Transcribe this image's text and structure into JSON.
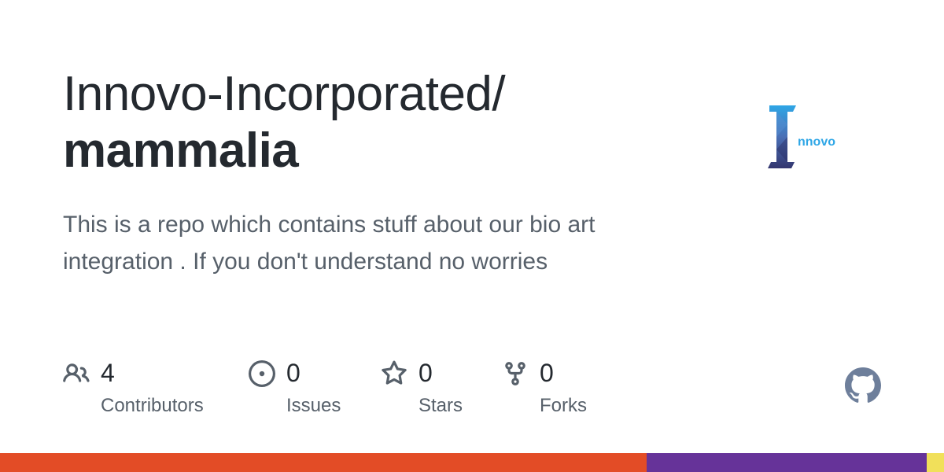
{
  "repo": {
    "owner": "Innovo-Incorporated/",
    "name": "mammalia",
    "description": "This is a repo which contains stuff about our bio art integration . If you don't understand no worries"
  },
  "logo": {
    "wordmark": "nnovo",
    "colors": {
      "dark": "#3b3f7e",
      "light": "#2ea6e6"
    }
  },
  "stats": [
    {
      "icon": "people-icon",
      "value": "4",
      "label": "Contributors"
    },
    {
      "icon": "issue-opened-icon",
      "value": "0",
      "label": "Issues"
    },
    {
      "icon": "star-icon",
      "value": "0",
      "label": "Stars"
    },
    {
      "icon": "repo-forked-icon",
      "value": "0",
      "label": "Forks"
    }
  ],
  "languages": [
    {
      "color": "#e34c26",
      "share": 0.685
    },
    {
      "color": "#663399",
      "share": 0.297
    },
    {
      "color": "#f1e05a",
      "share": 0.018
    }
  ],
  "colors": {
    "text": "#24292f",
    "muted": "#57606a",
    "github_mark": "#6e7f9b"
  }
}
